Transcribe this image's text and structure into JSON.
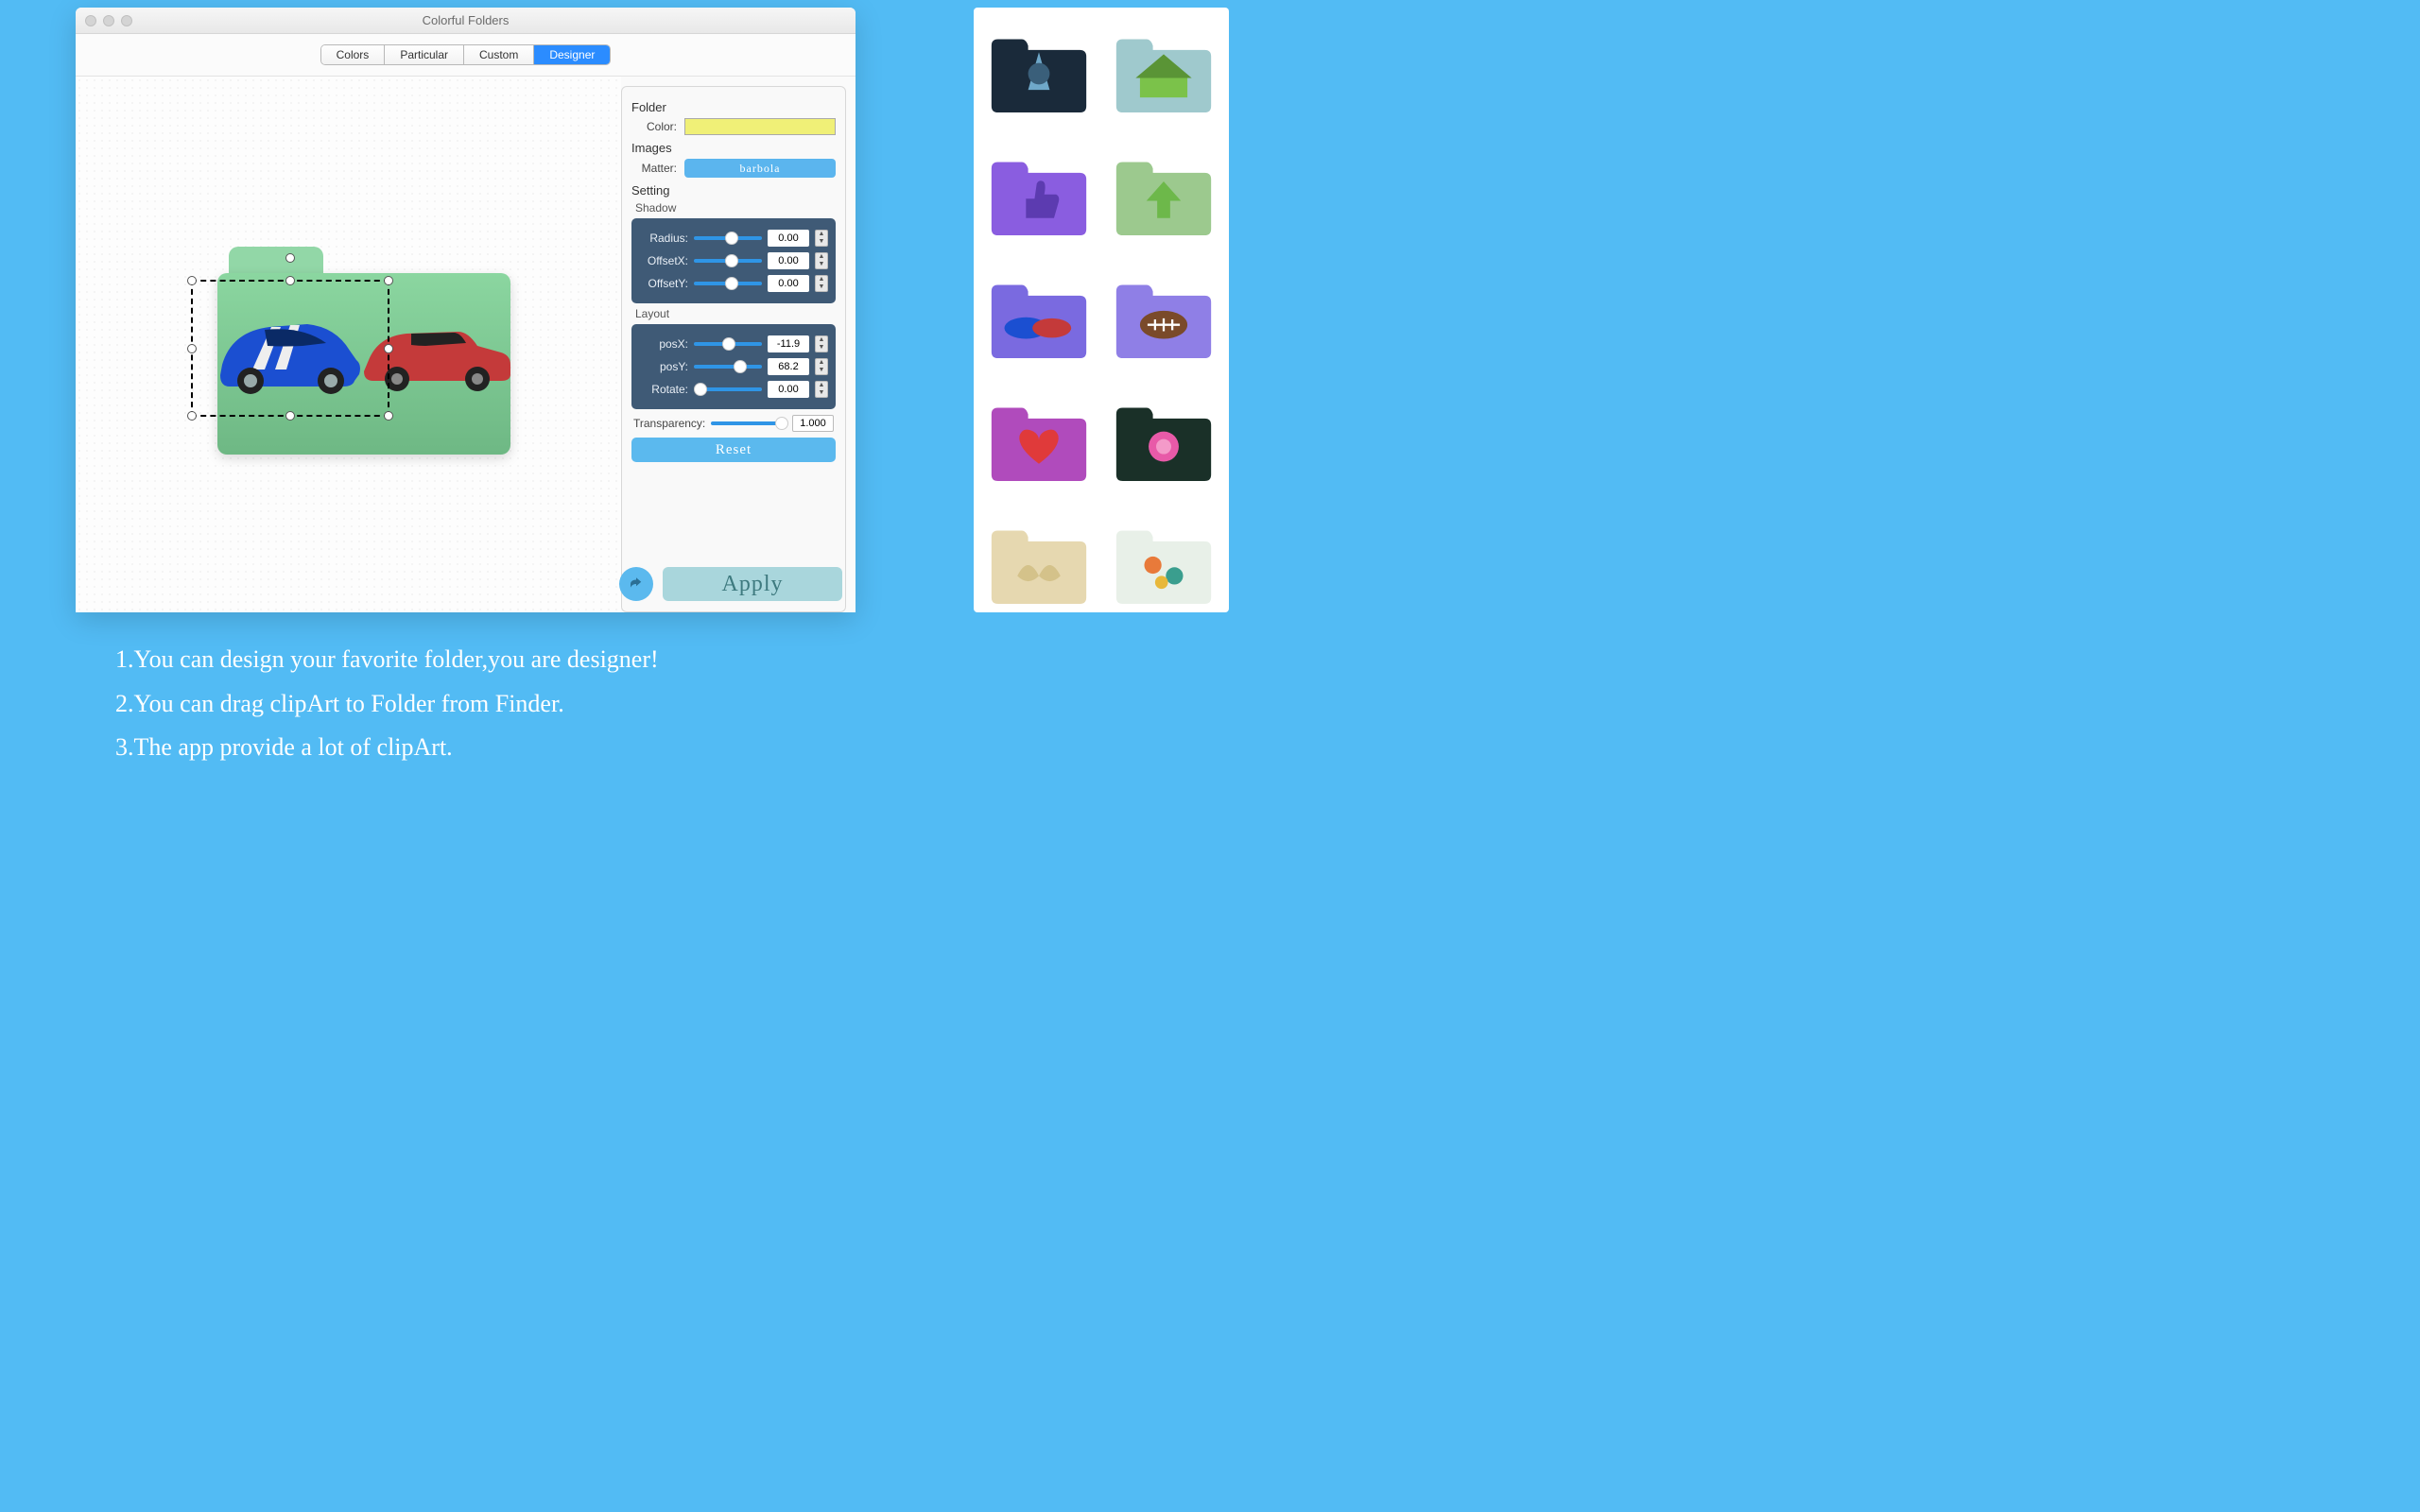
{
  "window": {
    "title": "Colorful Folders"
  },
  "tabs": [
    "Colors",
    "Particular",
    "Custom",
    "Designer"
  ],
  "active_tab": 3,
  "folder": {
    "section": "Folder",
    "color_label": "Color:",
    "color_value": "#f0f077"
  },
  "images": {
    "section": "Images",
    "matter_label": "Matter:",
    "matter_value": "barbola"
  },
  "setting": {
    "section": "Setting",
    "shadow_label": "Shadow",
    "layout_label": "Layout"
  },
  "shadow": {
    "radius_label": "Radius:",
    "radius_value": "0.00",
    "offsetx_label": "OffsetX:",
    "offsetx_value": "0.00",
    "offsety_label": "OffsetY:",
    "offsety_value": "0.00"
  },
  "layout": {
    "posx_label": "posX:",
    "posx_value": "-11.9",
    "posy_label": "posY:",
    "posy_value": "68.2",
    "rotate_label": "Rotate:",
    "rotate_value": "0.00"
  },
  "transparency": {
    "label": "Transparency:",
    "value": "1.000"
  },
  "buttons": {
    "reset": "Reset",
    "apply": "Apply"
  },
  "captions": [
    "1.You can design your favorite folder,you are designer!",
    "2.You can drag clipArt to Folder from Finder.",
    "3.The app provide a lot of clipArt."
  ],
  "gallery": [
    {
      "bg": "#1a2a3a",
      "deco": "creature"
    },
    {
      "bg": "#9fc9cd",
      "deco": "house"
    },
    {
      "bg": "#8a5de0",
      "deco": "thumb"
    },
    {
      "bg": "#9cc98e",
      "deco": "arrow"
    },
    {
      "bg": "#7a6ae0",
      "deco": "cars"
    },
    {
      "bg": "#8f7fe6",
      "deco": "football"
    },
    {
      "bg": "#b04bbc",
      "deco": "heart"
    },
    {
      "bg": "#1a3028",
      "deco": "rose"
    },
    {
      "bg": "#e6d8b0",
      "deco": "ornate"
    },
    {
      "bg": "#e8f0e8",
      "deco": "floral"
    }
  ]
}
